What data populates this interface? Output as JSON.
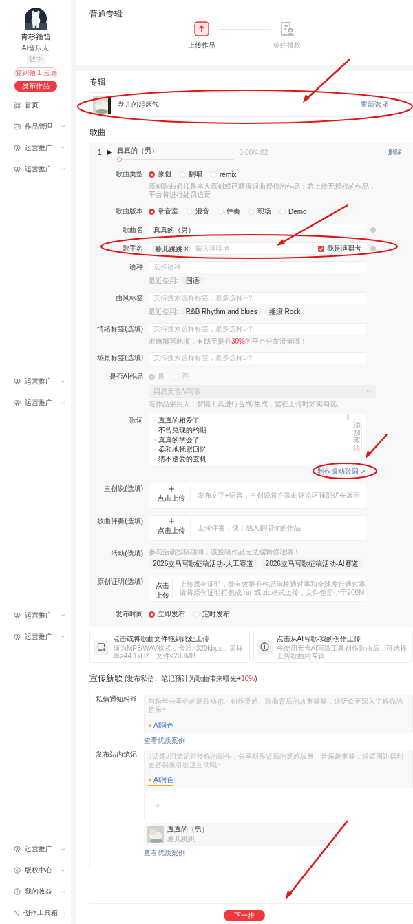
{
  "sidebar": {
    "profile": {
      "name": "青杉箍笛",
      "title": "AI音乐人",
      "role": "歌手"
    },
    "checkin_button": "签到领 1 云豆",
    "publish_button": "发布作品",
    "groups": [
      {
        "items": [
          {
            "kind": "home",
            "label": "首页",
            "expandable": false
          },
          {
            "kind": "works",
            "label": "作品管理",
            "expandable": true
          },
          {
            "kind": "promo",
            "label": "运营推广",
            "expandable": true
          },
          {
            "kind": "promo",
            "label": "运营推广",
            "expandable": true
          }
        ]
      },
      {
        "items": [
          {
            "kind": "promo",
            "label": "运营推广",
            "expandable": true
          },
          {
            "kind": "promo",
            "label": "运营推广",
            "expandable": true
          }
        ]
      },
      {
        "items": [
          {
            "kind": "promo",
            "label": "运营推广",
            "expandable": true
          },
          {
            "kind": "promo",
            "label": "运营推广",
            "expandable": true
          }
        ]
      },
      {
        "items": [
          {
            "kind": "promo",
            "label": "运营推广",
            "expandable": true
          },
          {
            "kind": "copyright",
            "label": "版权中心",
            "expandable": true
          },
          {
            "kind": "income",
            "label": "我的收益",
            "expandable": true
          },
          {
            "kind": "tools",
            "label": "创作工具箱",
            "expandable": true
          }
        ]
      }
    ]
  },
  "header": {
    "title": "普通专辑",
    "steps": [
      {
        "label": "上传作品",
        "selected": true
      },
      {
        "label": "签约授权",
        "selected": false
      }
    ]
  },
  "album": {
    "heading": "专辑",
    "name": "卷儿的起床气",
    "reselect": "重新选择"
  },
  "songs": {
    "heading": "歌曲",
    "track": {
      "index": "1",
      "title": "真真的（男）",
      "level": 0,
      "time": "0:00/4:02",
      "delete": "删除"
    },
    "fields": [
      {
        "kind": "radio",
        "label": "歌曲类型",
        "disabled": false,
        "options": [
          {
            "label": "原创",
            "selected": true
          },
          {
            "label": "翻唱",
            "selected": false
          },
          {
            "label": "remix",
            "selected": false
          }
        ],
        "hint": "原创歌曲必须是本人原创或已获得词曲授权的作品；若上传无授权的作品，平台将进行处罚追责"
      },
      {
        "kind": "radio",
        "label": "歌曲版本",
        "disabled": false,
        "options": [
          {
            "label": "录音室",
            "selected": true
          },
          {
            "label": "混音",
            "selected": false
          },
          {
            "label": "伴奏",
            "selected": false
          },
          {
            "label": "现场",
            "selected": false
          },
          {
            "label": "Demo",
            "selected": false
          }
        ]
      },
      {
        "kind": "input",
        "label": "歌曲名",
        "value": "真真的（男）",
        "help": true
      },
      {
        "kind": "singer",
        "label": "歌手名",
        "tags": [
          "卷儿跳跳"
        ],
        "tag_remove": "×",
        "placeholder": "输入演唱者",
        "checkbox": {
          "label": "我是演唱者",
          "checked": true
        },
        "help": true
      },
      {
        "kind": "input",
        "label": "语种",
        "placeholder": "选择语种",
        "recent_label": "最近使用:",
        "recent": [
          "国语"
        ]
      },
      {
        "kind": "input",
        "label": "曲风标签",
        "placeholder": "支持搜索选择标签，最多选择2个",
        "recent_label": "最近使用:",
        "recent": [
          "R&B Rhythm and blues",
          "摇滚 Rock"
        ]
      },
      {
        "kind": "input",
        "label": "情绪标签(选填)",
        "placeholder": "支持搜索选择标签，最多选择3个",
        "hint_parts": [
          {
            "text": "准确填写此项，有助于提升",
            "highlight": false
          },
          {
            "text": "30%",
            "highlight": true
          },
          {
            "text": "的平台分发流量哦！",
            "highlight": false
          }
        ]
      },
      {
        "kind": "input",
        "label": "场景标签(选填)",
        "placeholder": "支持搜索选择标签，最多选择3个"
      },
      {
        "kind": "radio",
        "label": "是否AI作品",
        "disabled": true,
        "options": [
          {
            "label": "是",
            "selected": true
          },
          {
            "label": "否",
            "selected": false
          }
        ],
        "select": {
          "value": "网易天音AI写歌",
          "disabled": true
        },
        "hint": "若作品采用人工智能工具进行合成/生成，需在上传时如实勾选。"
      },
      {
        "kind": "lyrics",
        "label": "歌词",
        "lines": [
          "真真的相爱了",
          "不曾兑现的约期",
          "真真的学会了",
          "柔和地抚慰回忆",
          "猜不透爱的玄机"
        ],
        "side_button": "添加双语",
        "link": "制作滚动歌词 >"
      },
      {
        "kind": "upload",
        "label": "主创说(选填)",
        "button": "点击上传",
        "description": [
          "发布文字+语音，主创说将在歌曲评论区顶部优先展示"
        ]
      },
      {
        "kind": "upload",
        "label": "歌曲伴奏(选填)",
        "button": "点击上传",
        "description": [
          "上传伴奏，便于他人翻唱你的作品"
        ]
      },
      {
        "kind": "chips",
        "label": "活动(选填)",
        "hint": "参与活动投稿期间，该投稿作品无法编辑修改哦！",
        "chips": [
          "2026立马写歌征稿活动-人工赛道",
          "2026立马写歌征稿活动-AI赛道"
        ]
      },
      {
        "kind": "upload",
        "label": "原创证明(选填)",
        "button": "点击上传",
        "description": [
          "上传原创证明，能有效提升作品审核通过率和全球发行通过率",
          "请将原创证明打包成 rar 或 zip格式上传，文件包需小于200M"
        ]
      },
      {
        "kind": "radio",
        "label": "发布时间",
        "disabled": false,
        "options": [
          {
            "label": "立即发布",
            "selected": true
          },
          {
            "label": "定时发布",
            "selected": false
          }
        ]
      }
    ]
  },
  "upload_sources": [
    {
      "kind": "file",
      "title": "点击或将歌曲文件拖到此处上传",
      "description": "须为MP3/WAV格式，音质>320kbps，采样率>44.1kHz，文件<200MB"
    },
    {
      "kind": "ai",
      "title": "点击从AI写歌-我的创作上传",
      "description": "先使用天音AI写歌工具创作歌曲后，可选择上传歌曲到专辑"
    }
  ],
  "promo": {
    "heading": "宣传新歌",
    "note_parts": [
      {
        "text": "(发布私信、笔记预计为歌曲带来曝光+",
        "highlight": false
      },
      {
        "text": "10%",
        "highlight": true
      },
      {
        "text": ")",
        "highlight": false
      }
    ],
    "fields": [
      {
        "label": "私信通知粉丝",
        "placeholder": "与粉丝分享你的新歌动态、创作灵感、歌曲背后的故事等等，让听众更深入了解你的音乐~",
        "ai_button": "AI润色",
        "image_add": false,
        "link": "查看优质案例"
      },
      {
        "label": "发布站内笔记",
        "placeholder": "#话题#用笔记宣传你的新作，分享创作背后的灵感故事、音乐趣事等，设置周边福利更容易吸引歌迷互动哦~",
        "ai_button": "AI润色",
        "image_add": true,
        "song": {
          "title": "真真的（男）",
          "artist": "卷儿跳跳"
        },
        "link": "查看优质案例"
      }
    ]
  },
  "next_button": "下一步"
}
